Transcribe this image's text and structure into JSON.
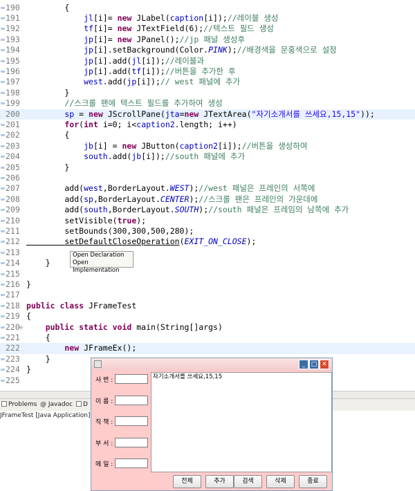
{
  "editor": {
    "lines": [
      {
        "num": "190",
        "fold": "",
        "current": false,
        "segs": [
          [
            "",
            "        {"
          ]
        ]
      },
      {
        "num": "191",
        "fold": "",
        "current": false,
        "segs": [
          [
            "fld",
            "            jl"
          ],
          [
            "",
            "[i]= "
          ],
          [
            "kw",
            "new"
          ],
          [
            "",
            " JLabel("
          ],
          [
            "fld",
            "caption"
          ],
          [
            "",
            "[i]);"
          ],
          [
            "cm",
            "//레이블 생성"
          ]
        ]
      },
      {
        "num": "192",
        "fold": "",
        "current": false,
        "segs": [
          [
            "fld",
            "            tf"
          ],
          [
            "",
            "[i]= "
          ],
          [
            "kw",
            "new"
          ],
          [
            "",
            " JTextField(6);"
          ],
          [
            "cm",
            "//텍스트 필드 생성"
          ]
        ]
      },
      {
        "num": "193",
        "fold": "",
        "current": false,
        "segs": [
          [
            "fld",
            "            jp"
          ],
          [
            "",
            "[i]= "
          ],
          [
            "kw",
            "new"
          ],
          [
            "",
            " JPanel();"
          ],
          [
            "cm",
            "//jp 패널 생성후"
          ]
        ]
      },
      {
        "num": "194",
        "fold": "",
        "current": false,
        "segs": [
          [
            "fld",
            "            jp"
          ],
          [
            "",
            "[i].setBackground(Color."
          ],
          [
            "stat",
            "PINK"
          ],
          [
            "",
            ");"
          ],
          [
            "cm",
            "//배경색을 문홍색으로 설정"
          ]
        ]
      },
      {
        "num": "195",
        "fold": "",
        "current": false,
        "segs": [
          [
            "fld",
            "            jp"
          ],
          [
            "",
            "[i].add("
          ],
          [
            "fld",
            "jl"
          ],
          [
            "",
            "[i]);"
          ],
          [
            "cm",
            "//레이블과"
          ]
        ]
      },
      {
        "num": "196",
        "fold": "",
        "current": false,
        "segs": [
          [
            "fld",
            "            jp"
          ],
          [
            "",
            "[i].add("
          ],
          [
            "fld",
            "tf"
          ],
          [
            "",
            "[i]);"
          ],
          [
            "cm",
            "//버튼을 추가한 후"
          ]
        ]
      },
      {
        "num": "197",
        "fold": "",
        "current": false,
        "segs": [
          [
            "fld",
            "            west"
          ],
          [
            "",
            ".add("
          ],
          [
            "fld",
            "jp"
          ],
          [
            "",
            "[i]);"
          ],
          [
            "cm",
            "// west 패널에 추가"
          ]
        ]
      },
      {
        "num": "198",
        "fold": "",
        "current": false,
        "segs": [
          [
            "",
            "        }"
          ]
        ]
      },
      {
        "num": "199",
        "fold": "",
        "current": false,
        "segs": [
          [
            "cm",
            "        //스크롤 팬에 텍스트 필드를 추가하여 생성"
          ]
        ]
      },
      {
        "num": "200",
        "fold": "",
        "current": true,
        "segs": [
          [
            "fld",
            "        sp"
          ],
          [
            "",
            " = "
          ],
          [
            "kw",
            "new"
          ],
          [
            "",
            " JScrollPane("
          ],
          [
            "fld",
            "jta"
          ],
          [
            "",
            "="
          ],
          [
            "kw",
            "new"
          ],
          [
            "",
            " JTextArea("
          ],
          [
            "str",
            "\"자기소개서를 쓰세요,15,15\""
          ],
          [
            "",
            "));"
          ]
        ]
      },
      {
        "num": "201",
        "fold": "",
        "current": false,
        "segs": [
          [
            "kw",
            "        for"
          ],
          [
            "",
            "("
          ],
          [
            "kw",
            "int"
          ],
          [
            "",
            " i=0; i<"
          ],
          [
            "fld",
            "caption2"
          ],
          [
            "",
            ".length; i++)"
          ]
        ]
      },
      {
        "num": "202",
        "fold": "",
        "current": false,
        "segs": [
          [
            "",
            "        {"
          ]
        ]
      },
      {
        "num": "203",
        "fold": "",
        "current": false,
        "segs": [
          [
            "fld",
            "            jb"
          ],
          [
            "",
            "[i] = "
          ],
          [
            "kw",
            "new"
          ],
          [
            "",
            " JButton("
          ],
          [
            "fld",
            "caption2"
          ],
          [
            "",
            "[i]);"
          ],
          [
            "cm",
            "//버튼을 생성하여"
          ]
        ]
      },
      {
        "num": "204",
        "fold": "",
        "current": false,
        "segs": [
          [
            "fld",
            "            south"
          ],
          [
            "",
            ".add("
          ],
          [
            "fld",
            "jb"
          ],
          [
            "",
            "[i]);"
          ],
          [
            "cm",
            "//south 패널에 추가"
          ]
        ]
      },
      {
        "num": "205",
        "fold": "",
        "current": false,
        "segs": [
          [
            "",
            "        }"
          ]
        ]
      },
      {
        "num": "206",
        "fold": "",
        "current": false,
        "segs": [
          [
            "",
            ""
          ]
        ]
      },
      {
        "num": "207",
        "fold": "",
        "current": false,
        "segs": [
          [
            "",
            "        add("
          ],
          [
            "fld",
            "west"
          ],
          [
            "",
            ",BorderLayout."
          ],
          [
            "stat",
            "WEST"
          ],
          [
            "",
            ");"
          ],
          [
            "cm",
            "//west 패널은 프레인의 서쪽에"
          ]
        ]
      },
      {
        "num": "208",
        "fold": "",
        "current": false,
        "segs": [
          [
            "",
            "        add("
          ],
          [
            "fld",
            "sp"
          ],
          [
            "",
            ",BorderLayout."
          ],
          [
            "stat",
            "CENTER"
          ],
          [
            "",
            ");"
          ],
          [
            "cm",
            "//스크롤 팬은 프레인의 가운데에"
          ]
        ]
      },
      {
        "num": "209",
        "fold": "",
        "current": false,
        "segs": [
          [
            "",
            "        add("
          ],
          [
            "fld",
            "south"
          ],
          [
            "",
            ",BorderLayout."
          ],
          [
            "stat",
            "SOUTH"
          ],
          [
            "",
            ");"
          ],
          [
            "cm",
            "//south 패널은 프레임의 남쪽에 추가"
          ]
        ]
      },
      {
        "num": "210",
        "fold": "",
        "current": false,
        "segs": [
          [
            "",
            "        setVisible("
          ],
          [
            "kw",
            "true"
          ],
          [
            "",
            ");"
          ]
        ]
      },
      {
        "num": "211",
        "fold": "",
        "current": false,
        "segs": [
          [
            "",
            "        setBounds(300,300,500,280);"
          ]
        ]
      },
      {
        "num": "212",
        "fold": "",
        "current": false,
        "segs": [
          [
            "u",
            "        setDefaultCloseOperation"
          ],
          [
            "",
            "("
          ],
          [
            "stat",
            "EXIT_ON_CLOSE"
          ],
          [
            "",
            ");"
          ]
        ]
      },
      {
        "num": "213",
        "fold": "",
        "current": false,
        "segs": [
          [
            "",
            ""
          ]
        ]
      },
      {
        "num": "214",
        "fold": "",
        "current": false,
        "segs": [
          [
            "",
            "    }"
          ]
        ]
      },
      {
        "num": "215",
        "fold": "",
        "current": false,
        "segs": [
          [
            "",
            ""
          ]
        ]
      },
      {
        "num": "216",
        "fold": "",
        "current": false,
        "segs": [
          [
            "",
            "}"
          ]
        ]
      },
      {
        "num": "217",
        "fold": "",
        "current": false,
        "segs": [
          [
            "",
            ""
          ]
        ]
      },
      {
        "num": "218",
        "fold": "",
        "current": false,
        "segs": [
          [
            "kw",
            "public class"
          ],
          [
            "",
            " JFrameTest"
          ]
        ]
      },
      {
        "num": "219",
        "fold": "",
        "current": false,
        "segs": [
          [
            "",
            "{"
          ]
        ]
      },
      {
        "num": "220",
        "fold": "⊖",
        "current": false,
        "segs": [
          [
            "kw",
            "    public static void"
          ],
          [
            "",
            " main(String[]args)"
          ]
        ]
      },
      {
        "num": "221",
        "fold": "",
        "current": false,
        "segs": [
          [
            "",
            "    {"
          ]
        ]
      },
      {
        "num": "222",
        "fold": "",
        "current": true,
        "segs": [
          [
            "kw",
            "        new"
          ],
          [
            "",
            " JFrameEx();"
          ]
        ]
      },
      {
        "num": "223",
        "fold": "",
        "current": false,
        "segs": [
          [
            "",
            "    }"
          ]
        ]
      },
      {
        "num": "224",
        "fold": "",
        "current": false,
        "segs": [
          [
            "",
            "}"
          ]
        ]
      },
      {
        "num": "225",
        "fold": "",
        "current": false,
        "segs": [
          [
            "",
            ""
          ]
        ]
      }
    ],
    "hover_popup": {
      "items": [
        "Open Declaration",
        "Open Implementation"
      ]
    }
  },
  "bottom_panel": {
    "tabs": [
      {
        "label": "Problems",
        "icon": "problems-icon"
      },
      {
        "label": "@ Javadoc",
        "icon": "javadoc-icon"
      },
      {
        "label": "D",
        "icon": "declaration-icon"
      }
    ],
    "console_header": "JFrameTest [Java Application] C"
  },
  "jframe": {
    "window_buttons": {
      "minimize": "_",
      "maximize": "□",
      "close": "✕"
    },
    "fields": [
      {
        "label": "사 번 :",
        "value": ""
      },
      {
        "label": "이 름 :",
        "value": ""
      },
      {
        "label": "직 책 :",
        "value": ""
      },
      {
        "label": "부 서 :",
        "value": ""
      },
      {
        "label": "메 일 :",
        "value": ""
      }
    ],
    "textarea_text": "자기소개서를 쓰세요,15,15",
    "buttons": [
      "전체",
      "추가",
      "검색",
      "삭제",
      "종료"
    ]
  },
  "colors": {
    "frame_bg": "#ffcccc",
    "keyword": "#7f0055",
    "field": "#0000c0",
    "comment": "#3f7f5f",
    "string": "#2a00ff"
  }
}
